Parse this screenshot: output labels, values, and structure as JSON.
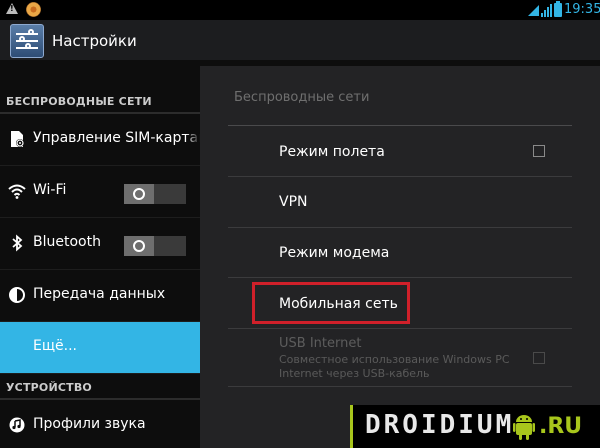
{
  "status_bar": {
    "time": "19:35"
  },
  "action_bar": {
    "title": "Настройки",
    "icon": "settings-sliders-icon"
  },
  "sidebar": {
    "section_wireless": "БЕСПРОВОДНЫЕ СЕТИ",
    "items": [
      {
        "label": "Управление SIM-картам",
        "icon": "sim-card-icon"
      },
      {
        "label": "Wi-Fi",
        "icon": "wifi-icon",
        "toggle": "off"
      },
      {
        "label": "Bluetooth",
        "icon": "bluetooth-icon",
        "toggle": "off"
      },
      {
        "label": "Передача данных",
        "icon": "data-usage-icon"
      },
      {
        "label": "Ещё...",
        "icon": "",
        "selected": true
      }
    ],
    "section_device": "УСТРОЙСТВО",
    "device_items": [
      {
        "label": "Профили звука",
        "icon": "sound-profile-icon"
      }
    ]
  },
  "main": {
    "title": "Беспроводные сети",
    "rows": [
      {
        "label": "Режим полета",
        "checkbox": false
      },
      {
        "label": "VPN"
      },
      {
        "label": "Режим модема"
      },
      {
        "label": "Мобильная сеть",
        "highlighted": true
      },
      {
        "label": "USB Internet",
        "subtitle_line1": "Совместное использование Windows PC",
        "subtitle_line2": "Internet через USB-кабель",
        "checkbox": false,
        "disabled": true
      }
    ]
  },
  "watermark": {
    "text": "DROIDIUM",
    "suffix": ".RU"
  },
  "colors": {
    "accent": "#33b5e5",
    "highlight_border": "#d0202a",
    "watermark_green": "#a8c61c"
  }
}
